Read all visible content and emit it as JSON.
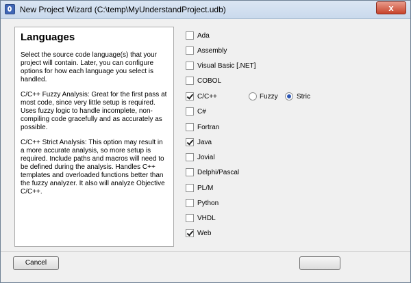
{
  "window": {
    "title": "New Project Wizard (C:\\temp\\MyUnderstandProject.udb)",
    "close_glyph": "x"
  },
  "left": {
    "heading": "Languages",
    "paragraphs": [
      "Select the source code language(s) that your project will contain. Later, you can configure options for how each language you select is handled.",
      "C/C++ Fuzzy Analysis: Great for the first pass at most code, since very little setup is required. Uses fuzzy logic to handle incomplete, non-compiling code gracefully and as accurately as possible.",
      "C/C++ Strict Analysis: This option may result in a more accurate analysis, so more setup is required. Include paths and macros will need to be defined during the analysis. Handles C++ templates and overloaded functions better than the fuzzy analyzer. It also will analyze Objective C/C++."
    ]
  },
  "languages": [
    {
      "label": "Ada",
      "checked": false
    },
    {
      "label": "Assembly",
      "checked": false
    },
    {
      "label": "Visual Basic [.NET]",
      "checked": false
    },
    {
      "label": "COBOL",
      "checked": false
    },
    {
      "label": "C/C++",
      "checked": true
    },
    {
      "label": "C#",
      "checked": false
    },
    {
      "label": "Fortran",
      "checked": false
    },
    {
      "label": "Java",
      "checked": true
    },
    {
      "label": "Jovial",
      "checked": false
    },
    {
      "label": "Delphi/Pascal",
      "checked": false
    },
    {
      "label": "PL/M",
      "checked": false
    },
    {
      "label": "Python",
      "checked": false
    },
    {
      "label": "VHDL",
      "checked": false
    },
    {
      "label": "Web",
      "checked": true
    }
  ],
  "cpp_mode": {
    "fuzzy_label": "Fuzzy",
    "strict_label": "Stric",
    "selected": "strict"
  },
  "buttons": {
    "cancel": "Cancel"
  },
  "colors": {
    "radio_selected": "#2b55b3",
    "title_bar": "#dbe6f3"
  }
}
